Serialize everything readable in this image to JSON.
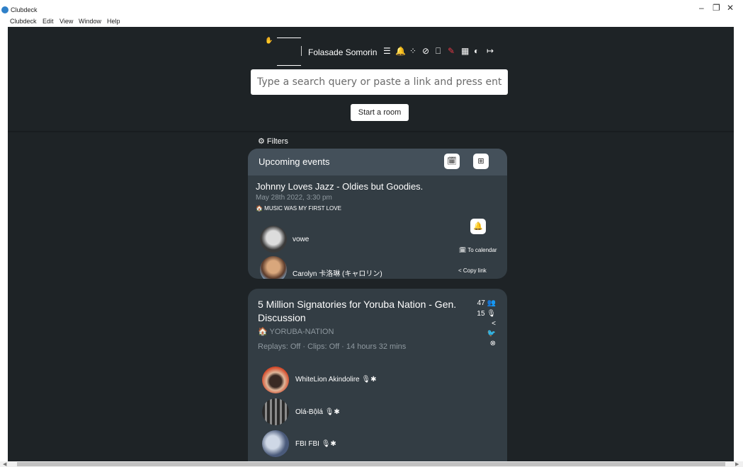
{
  "window": {
    "title": "Clubdeck",
    "controls": [
      "–",
      "❐",
      "✕"
    ]
  },
  "menu": [
    "Clubdeck",
    "Edit",
    "View",
    "Window",
    "Help"
  ],
  "header": {
    "hand_icon": "✋",
    "user_name": "Folasade Somorin",
    "nav_icons": [
      "sliders-icon",
      "bell-icon",
      "spinner-icon",
      "compass-icon",
      "bookmark-icon",
      "megaphone-icon",
      "building-icon",
      "contrast-icon",
      "sign-out-icon"
    ],
    "nav_glyphs": [
      "☰",
      "🔔",
      "⁘",
      "⊘",
      "⎕",
      "✎",
      "▦",
      "◐",
      "↦"
    ],
    "accent_color": "#e63946"
  },
  "search": {
    "placeholder": "Type a search query or paste a link and press enter",
    "value": ""
  },
  "start_room_label": "Start a room",
  "filters_label": "⚙ Filters",
  "upcoming": {
    "title": "Upcoming events",
    "event": {
      "title": "Johnny Loves Jazz - Oldies but Goodies.",
      "date": "May 28th 2022, 3:30 pm",
      "club": "🏠 MUSIC WAS MY FIRST LOVE",
      "to_calendar": "🗓 To calendar",
      "copy_link": "< Copy link",
      "speakers": [
        "vowe",
        "Carolyn 卡洛琳 (キャロリン)"
      ]
    }
  },
  "room": {
    "title": "5 Million Signatories for Yoruba Nation - Gen. Discussion",
    "club": "🏠 YORUBA-NATION",
    "meta": "Replays: Off · Clips: Off · 14 hours 32 mins",
    "listeners": "47 👥",
    "speakers_count": "15 🎙",
    "share_icon": "<",
    "twitter_icon": "🐦",
    "hide_icon": "⊗",
    "speakers": [
      {
        "name": "WhiteLion Akindolire",
        "badges": "🎙✱"
      },
      {
        "name": "Olá-Bộlá",
        "badges": "🎙✱"
      },
      {
        "name": "FBI FBI",
        "badges": "🎙✱"
      }
    ]
  }
}
